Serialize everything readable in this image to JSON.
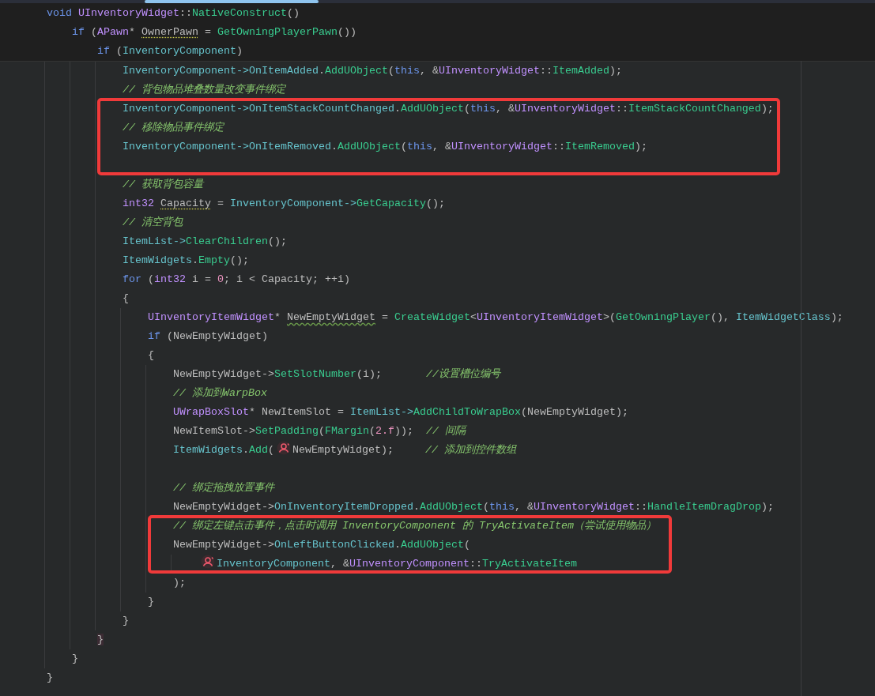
{
  "editor": {
    "lines": [
      {
        "pinned": true,
        "tokens": [
          {
            "kind": "kw",
            "text": "void "
          },
          {
            "kind": "type",
            "text": "UInventoryWidget"
          },
          {
            "kind": "plain",
            "text": "::"
          },
          {
            "kind": "fn",
            "text": "NativeConstruct"
          },
          {
            "kind": "plain",
            "text": "()"
          }
        ],
        "children": [
          {
            "pinned": true,
            "tokens": [
              {
                "kind": "kw",
                "text": "if"
              },
              {
                "kind": "plain",
                "text": " ("
              },
              {
                "kind": "type",
                "text": "APawn"
              },
              {
                "kind": "plain",
                "text": "* "
              },
              {
                "kind": "plain",
                "text": "OwnerPawn",
                "dotted_underline": true
              },
              {
                "kind": "plain",
                "text": " = "
              },
              {
                "kind": "fn",
                "text": "GetOwningPlayerPawn"
              },
              {
                "kind": "plain",
                "text": "())"
              }
            ],
            "children": [
              {
                "pinned": true,
                "tokens": [
                  {
                    "kind": "kw",
                    "text": "if"
                  },
                  {
                    "kind": "plain",
                    "text": " ("
                  },
                  {
                    "kind": "field",
                    "text": "InventoryComponent"
                  },
                  {
                    "kind": "plain",
                    "text": ")"
                  }
                ],
                "children": [
                  {
                    "tokens": [
                      {
                        "kind": "field",
                        "text": "InventoryComponent->OnItemAdded"
                      },
                      {
                        "kind": "plain",
                        "text": "."
                      },
                      {
                        "kind": "fn",
                        "text": "AddUObject"
                      },
                      {
                        "kind": "plain",
                        "text": "("
                      },
                      {
                        "kind": "kw",
                        "text": "this"
                      },
                      {
                        "kind": "plain",
                        "text": ", &"
                      },
                      {
                        "kind": "type",
                        "text": "UInventoryWidget"
                      },
                      {
                        "kind": "plain",
                        "text": "::"
                      },
                      {
                        "kind": "fn",
                        "text": "ItemAdded"
                      },
                      {
                        "kind": "plain",
                        "text": ");"
                      }
                    ]
                  },
                  {
                    "tokens": [
                      {
                        "kind": "comment",
                        "text": "// 背包物品堆叠数量改变事件绑定"
                      }
                    ]
                  },
                  {
                    "in_box": true,
                    "tokens": [
                      {
                        "kind": "field",
                        "text": "InventoryComponent->OnItemStackCountChanged"
                      },
                      {
                        "kind": "plain",
                        "text": "."
                      },
                      {
                        "kind": "fn",
                        "text": "AddUObject"
                      },
                      {
                        "kind": "plain",
                        "text": "("
                      },
                      {
                        "kind": "kw",
                        "text": "this"
                      },
                      {
                        "kind": "plain",
                        "text": ", &"
                      },
                      {
                        "kind": "type",
                        "text": "UInventoryWidget"
                      },
                      {
                        "kind": "plain",
                        "text": "::"
                      },
                      {
                        "kind": "fn",
                        "text": "ItemStackCountChanged"
                      },
                      {
                        "kind": "plain",
                        "text": ");"
                      }
                    ]
                  },
                  {
                    "in_box": true,
                    "tokens": [
                      {
                        "kind": "comment",
                        "text": "// 移除物品事件绑定"
                      }
                    ]
                  },
                  {
                    "in_box": true,
                    "tokens": [
                      {
                        "kind": "field",
                        "text": "InventoryComponent->OnItemRemoved"
                      },
                      {
                        "kind": "plain",
                        "text": "."
                      },
                      {
                        "kind": "fn",
                        "text": "AddUObject"
                      },
                      {
                        "kind": "plain",
                        "text": "("
                      },
                      {
                        "kind": "kw",
                        "text": "this"
                      },
                      {
                        "kind": "plain",
                        "text": ", &"
                      },
                      {
                        "kind": "type",
                        "text": "UInventoryWidget"
                      },
                      {
                        "kind": "plain",
                        "text": "::"
                      },
                      {
                        "kind": "fn",
                        "text": "ItemRemoved"
                      },
                      {
                        "kind": "plain",
                        "text": ");"
                      }
                    ]
                  },
                  {
                    "in_box": true,
                    "blank": true
                  },
                  {
                    "tokens": [
                      {
                        "kind": "comment",
                        "text": "// 获取背包容量"
                      }
                    ]
                  },
                  {
                    "tokens": [
                      {
                        "kind": "type",
                        "text": "int32 "
                      },
                      {
                        "kind": "plain",
                        "text": "Capacity",
                        "dotted_underline": true
                      },
                      {
                        "kind": "plain",
                        "text": " = "
                      },
                      {
                        "kind": "field",
                        "text": "InventoryComponent->"
                      },
                      {
                        "kind": "fn",
                        "text": "GetCapacity"
                      },
                      {
                        "kind": "plain",
                        "text": "();"
                      }
                    ]
                  },
                  {
                    "tokens": [
                      {
                        "kind": "comment",
                        "text": "// 清空背包"
                      }
                    ]
                  },
                  {
                    "tokens": [
                      {
                        "kind": "field",
                        "text": "ItemList->"
                      },
                      {
                        "kind": "fn",
                        "text": "ClearChildren"
                      },
                      {
                        "kind": "plain",
                        "text": "();"
                      }
                    ]
                  },
                  {
                    "tokens": [
                      {
                        "kind": "field",
                        "text": "ItemWidgets"
                      },
                      {
                        "kind": "plain",
                        "text": "."
                      },
                      {
                        "kind": "fn",
                        "text": "Empty"
                      },
                      {
                        "kind": "plain",
                        "text": "();"
                      }
                    ]
                  },
                  {
                    "tokens": [
                      {
                        "kind": "kw",
                        "text": "for"
                      },
                      {
                        "kind": "plain",
                        "text": " ("
                      },
                      {
                        "kind": "type",
                        "text": "int32"
                      },
                      {
                        "kind": "plain",
                        "text": " i = "
                      },
                      {
                        "kind": "num",
                        "text": "0"
                      },
                      {
                        "kind": "plain",
                        "text": "; i < Capacity; ++i)"
                      }
                    ]
                  },
                  {
                    "tokens": [
                      {
                        "kind": "plain",
                        "text": "{"
                      }
                    ],
                    "children": [
                      {
                        "tokens": [
                          {
                            "kind": "type",
                            "text": "UInventoryItemWidget"
                          },
                          {
                            "kind": "plain",
                            "text": "* "
                          },
                          {
                            "kind": "plain",
                            "text": "NewEmptyWidget",
                            "wavy_underline": true
                          },
                          {
                            "kind": "plain",
                            "text": " = "
                          },
                          {
                            "kind": "fn",
                            "text": "CreateWidget"
                          },
                          {
                            "kind": "plain",
                            "text": "<"
                          },
                          {
                            "kind": "type",
                            "text": "UInventoryItemWidget"
                          },
                          {
                            "kind": "plain",
                            "text": ">("
                          },
                          {
                            "kind": "fn",
                            "text": "GetOwningPlayer"
                          },
                          {
                            "kind": "plain",
                            "text": "(), "
                          },
                          {
                            "kind": "field",
                            "text": "ItemWidgetClass"
                          },
                          {
                            "kind": "plain",
                            "text": ");"
                          }
                        ]
                      },
                      {
                        "tokens": [
                          {
                            "kind": "kw",
                            "text": "if"
                          },
                          {
                            "kind": "plain",
                            "text": " (NewEmptyWidget)"
                          }
                        ]
                      },
                      {
                        "tokens": [
                          {
                            "kind": "plain",
                            "text": "{"
                          }
                        ],
                        "children": [
                          {
                            "tokens": [
                              {
                                "kind": "plain",
                                "text": "NewEmptyWidget->"
                              },
                              {
                                "kind": "fn",
                                "text": "SetSlotNumber"
                              },
                              {
                                "kind": "plain",
                                "text": "(i);       "
                              },
                              {
                                "kind": "comment",
                                "text": "//设置槽位编号"
                              }
                            ]
                          },
                          {
                            "tokens": [
                              {
                                "kind": "comment",
                                "text": "// 添加到WarpBox"
                              }
                            ]
                          },
                          {
                            "tokens": [
                              {
                                "kind": "type",
                                "text": "UWrapBoxSlot"
                              },
                              {
                                "kind": "plain",
                                "text": "* NewItemSlot = "
                              },
                              {
                                "kind": "field",
                                "text": "ItemList->"
                              },
                              {
                                "kind": "fn",
                                "text": "AddChildToWrapBox"
                              },
                              {
                                "kind": "plain",
                                "text": "(NewEmptyWidget);"
                              }
                            ]
                          },
                          {
                            "tokens": [
                              {
                                "kind": "plain",
                                "text": "NewItemSlot->"
                              },
                              {
                                "kind": "fn",
                                "text": "SetPadding"
                              },
                              {
                                "kind": "plain",
                                "text": "("
                              },
                              {
                                "kind": "fn",
                                "text": "FMargin"
                              },
                              {
                                "kind": "plain",
                                "text": "("
                              },
                              {
                                "kind": "num",
                                "text": "2.f"
                              },
                              {
                                "kind": "plain",
                                "text": "));  "
                              },
                              {
                                "kind": "comment",
                                "text": "// 间隔"
                              }
                            ]
                          },
                          {
                            "tokens": [
                              {
                                "kind": "field",
                                "text": "ItemWidgets"
                              },
                              {
                                "kind": "plain",
                                "text": "."
                              },
                              {
                                "kind": "fn",
                                "text": "Add"
                              },
                              {
                                "kind": "plain",
                                "text": "("
                              },
                              {
                                "kind": "hint-icon"
                              },
                              {
                                "kind": "plain",
                                "text": "NewEmptyWidget);     "
                              },
                              {
                                "kind": "comment",
                                "text": "// 添加到控件数组"
                              }
                            ]
                          },
                          {
                            "blank": true
                          },
                          {
                            "tokens": [
                              {
                                "kind": "comment",
                                "text": "// 绑定拖拽放置事件"
                              }
                            ]
                          },
                          {
                            "tokens": [
                              {
                                "kind": "plain",
                                "text": "NewEmptyWidget->"
                              },
                              {
                                "kind": "field",
                                "text": "OnInventoryItemDropped"
                              },
                              {
                                "kind": "plain",
                                "text": "."
                              },
                              {
                                "kind": "fn",
                                "text": "AddUObject"
                              },
                              {
                                "kind": "plain",
                                "text": "("
                              },
                              {
                                "kind": "kw",
                                "text": "this"
                              },
                              {
                                "kind": "plain",
                                "text": ", &"
                              },
                              {
                                "kind": "type",
                                "text": "UInventoryWidget"
                              },
                              {
                                "kind": "plain",
                                "text": "::"
                              },
                              {
                                "kind": "fn",
                                "text": "HandleItemDragDrop"
                              },
                              {
                                "kind": "plain",
                                "text": ");"
                              }
                            ]
                          },
                          {
                            "in_box": true,
                            "tokens": [
                              {
                                "kind": "comment",
                                "text": "// 绑定左键点击事件，点击时调用 InventoryComponent 的 TryActivateItem（尝试使用物品）"
                              }
                            ]
                          },
                          {
                            "in_box": true,
                            "tokens": [
                              {
                                "kind": "plain",
                                "text": "NewEmptyWidget->"
                              },
                              {
                                "kind": "field",
                                "text": "OnLeftButtonClicked"
                              },
                              {
                                "kind": "plain",
                                "text": "."
                              },
                              {
                                "kind": "fn",
                                "text": "AddUObject"
                              },
                              {
                                "kind": "plain",
                                "text": "("
                              }
                            ],
                            "children": [
                              {
                                "in_box": true,
                                "tokens": [
                                  {
                                    "kind": "hint-icon"
                                  },
                                  {
                                    "kind": "field",
                                    "text": "InventoryComponent"
                                  },
                                  {
                                    "kind": "plain",
                                    "text": ", &"
                                  },
                                  {
                                    "kind": "type",
                                    "text": "UInventoryComponent"
                                  },
                                  {
                                    "kind": "plain",
                                    "text": "::"
                                  },
                                  {
                                    "kind": "fn",
                                    "text": "TryActivateItem"
                                  }
                                ]
                              }
                            ]
                          },
                          {
                            "tokens": [
                              {
                                "kind": "plain",
                                "text": ");"
                              }
                            ]
                          }
                        ]
                      },
                      {
                        "tokens": [
                          {
                            "kind": "plain",
                            "text": "}"
                          }
                        ]
                      }
                    ]
                  },
                  {
                    "tokens": [
                      {
                        "kind": "plain",
                        "text": "}"
                      }
                    ]
                  }
                ]
              },
              {
                "tokens": [
                  {
                    "kind": "plain",
                    "text": "}",
                    "matched": true
                  }
                ]
              }
            ]
          },
          {
            "tokens": [
              {
                "kind": "plain",
                "text": "}"
              }
            ]
          }
        ]
      },
      {
        "tokens": [
          {
            "kind": "plain",
            "text": "}"
          }
        ]
      }
    ]
  }
}
